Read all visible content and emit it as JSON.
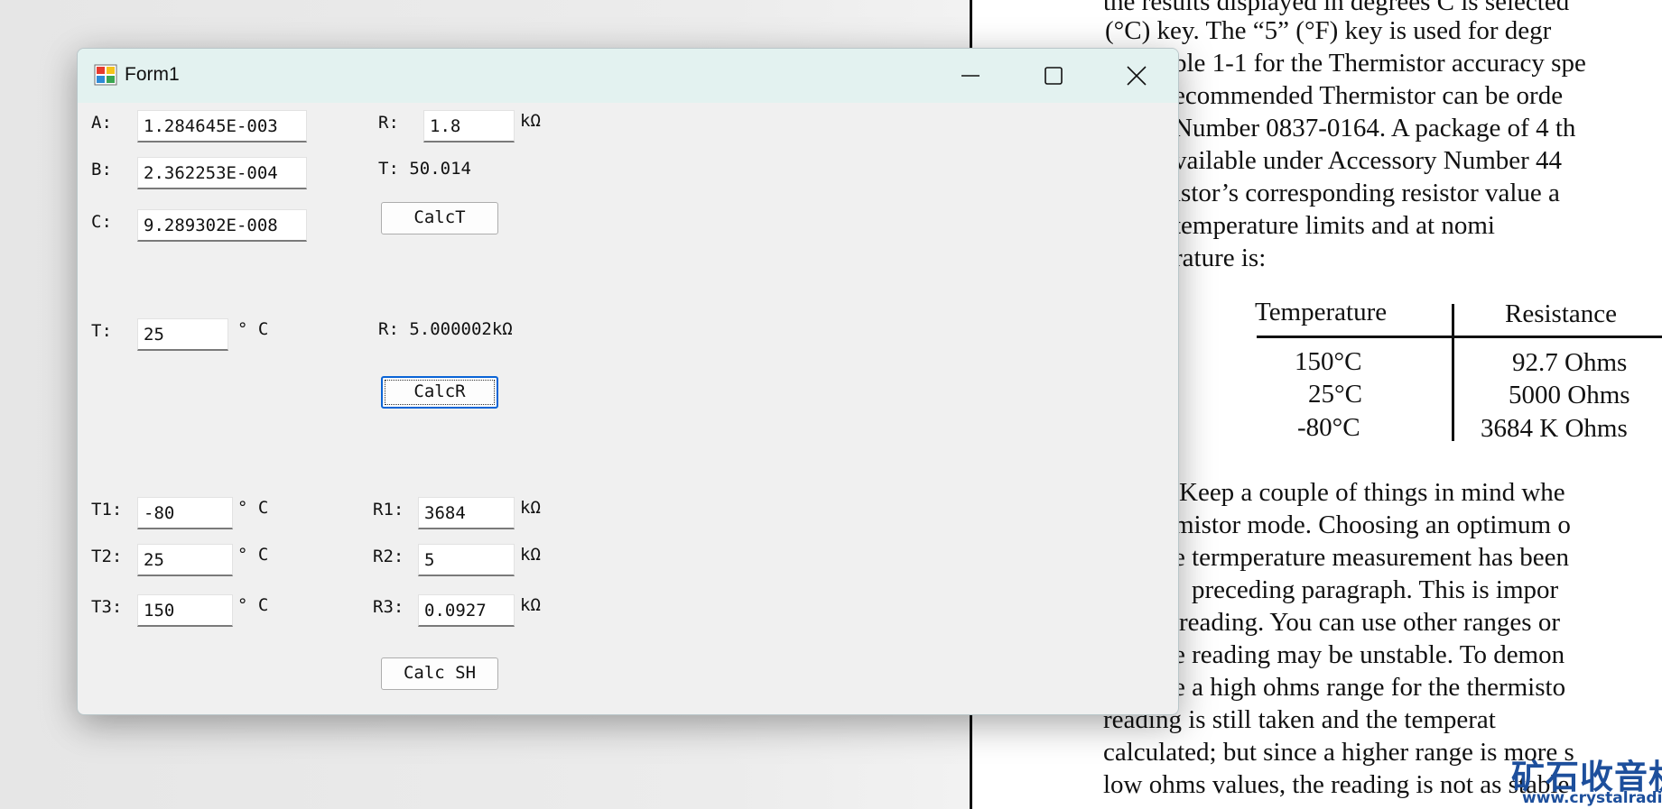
{
  "window": {
    "title": "Form1",
    "controls": {
      "minimize_icon": "minimize-icon",
      "maximize_icon": "maximize-icon",
      "close_icon": "close-icon"
    }
  },
  "coefficients": {
    "a_label": "A:",
    "a_value": "1.284645E-003",
    "b_label": "B:",
    "b_value": "2.362253E-004",
    "c_label": "C:",
    "c_value": "9.289302E-008"
  },
  "calc_t": {
    "r_label": "R:",
    "r_value": "1.8",
    "r_unit": "kΩ",
    "t_result": "T: 50.014",
    "button_label": "CalcT"
  },
  "calc_r": {
    "t_label": "T:",
    "t_value": "25",
    "t_unit": "° C",
    "r_result": "R: 5.000002kΩ",
    "button_label": "CalcR"
  },
  "calc_sh": {
    "rows": [
      {
        "t_label": "T1:",
        "t_value": "-80",
        "t_unit": "° C",
        "r_label": "R1:",
        "r_value": "3684",
        "r_unit": "kΩ"
      },
      {
        "t_label": "T2:",
        "t_value": "25",
        "t_unit": "° C",
        "r_label": "R2:",
        "r_value": "5",
        "r_unit": "kΩ"
      },
      {
        "t_label": "T3:",
        "t_value": "150",
        "t_unit": "° C",
        "r_label": "R3:",
        "r_value": "0.0927",
        "r_unit": "kΩ"
      }
    ],
    "button_label": "Calc SH"
  },
  "document": {
    "lines": [
      "the results displayed in degrees C is selected",
      "(°C) key. The “5” (°F) key is used for degr",
      "ble 1-1 for the Thermistor accuracy spe",
      "ecommended Thermistor can be orde",
      "Number 0837-0164. A package of 4 th",
      "vailable under Accessory Number 44",
      "istor’s corresponding resistor value a",
      "temperature  limits  and  at  nomi",
      "rature is:"
    ],
    "table": {
      "headers": [
        "Temperature",
        "Resistance"
      ],
      "rows": [
        [
          "150°C",
          "92.7 Ohms"
        ],
        [
          "25°C",
          "5000 Ohms"
        ],
        [
          "-80°C",
          "3684 K Ohms"
        ]
      ]
    },
    "lines2": [
      "Keep a couple of things in mind whe",
      "mistor mode. Choosing an optimum o",
      "e termperature measurement has been",
      "preceding paragraph. This is impor",
      "reading. You can use other ranges or",
      "e reading may be unstable. To demon",
      "e a high ohms range for the thermisto",
      "reading  is  still  taken  and  the  temperat",
      "calculated; but since a higher range is more s",
      "low ohms values, the reading is not as stable"
    ],
    "watermark": "矿石收音机",
    "watermark_url": "www.crystalradio.cn"
  }
}
